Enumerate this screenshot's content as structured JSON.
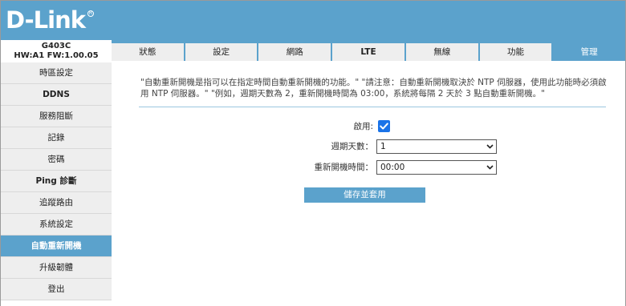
{
  "brand": {
    "logo": "D-Link",
    "reg": "R"
  },
  "model": {
    "name": "G403C",
    "hw_fw": "HW:A1   FW:1.00.05"
  },
  "sidebar": {
    "items": [
      {
        "label": "時區設定"
      },
      {
        "label": "DDNS"
      },
      {
        "label": "服務阻斷"
      },
      {
        "label": "記錄"
      },
      {
        "label": "密碼"
      },
      {
        "label": "Ping 診斷"
      },
      {
        "label": "追蹤路由"
      },
      {
        "label": "系統設定"
      },
      {
        "label": "自動重新開機"
      },
      {
        "label": "升級韌體"
      },
      {
        "label": "登出"
      }
    ],
    "active_index": 8
  },
  "tabs": [
    {
      "label": "狀態"
    },
    {
      "label": "設定"
    },
    {
      "label": "網路"
    },
    {
      "label": "LTE"
    },
    {
      "label": "無線"
    },
    {
      "label": "功能"
    },
    {
      "label": "管理"
    }
  ],
  "main": {
    "note": "\"自動重新開機是指可以在指定時間自動重新開機的功能。\" \"請注意：自動重新開機取決於 NTP 伺服器，使用此功能時必須啟用 NTP 伺服器。\" \"例如，週期天數為 2，重新開機時間為 03:00，系統將每隔 2 天於 3 點自動重新開機。\"",
    "enable_label": "啟用:",
    "enable_checked": true,
    "cycle_label": "週期天數：",
    "cycle_value": "1",
    "reboot_time_label": "重新開機時間：",
    "reboot_time_value": "00:00",
    "save_button": "儲存並套用"
  },
  "colors": {
    "accent": "#5ba2cc",
    "checkbox": "#1a73e8",
    "sidebar_bg": "#eeeeee"
  },
  "icons": {
    "select_caret": "chevron-down-icon",
    "checkbox_mark": "check-icon"
  }
}
